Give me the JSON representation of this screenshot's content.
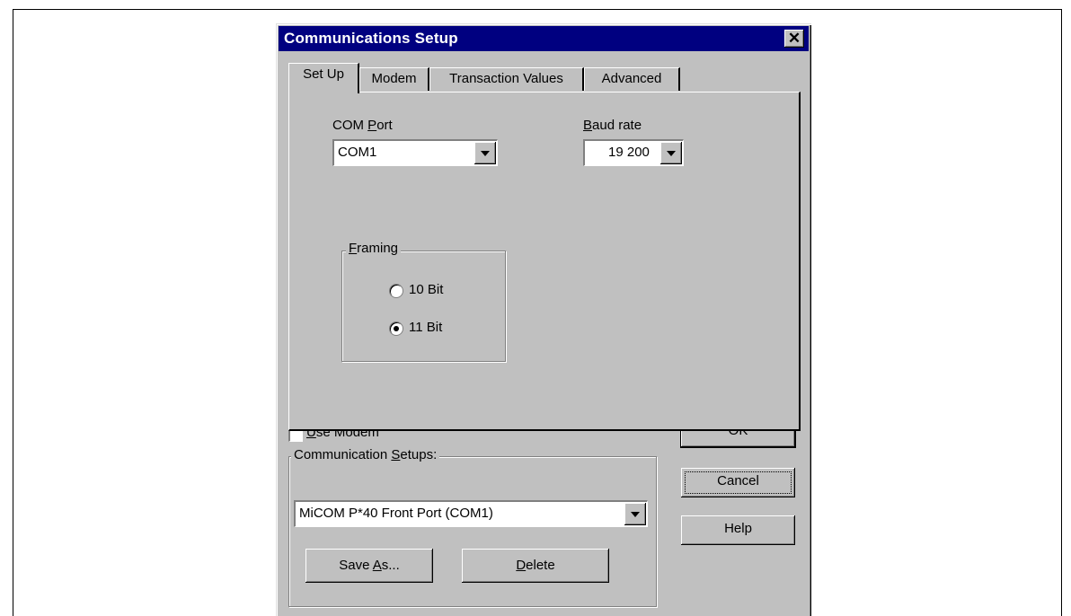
{
  "dialog": {
    "title": "Communications Setup",
    "close_symbol": "✕"
  },
  "tabs": [
    {
      "label": "Set Up",
      "active": true
    },
    {
      "label": "Modem",
      "active": false
    },
    {
      "label": "Transaction Values",
      "active": false
    },
    {
      "label": "Advanced",
      "active": false
    }
  ],
  "setup": {
    "com_port": {
      "label_first": "COM ",
      "label_mnemonic": "P",
      "label_rest": "ort",
      "value": "COM1"
    },
    "baud_rate": {
      "label_mnemonic": "B",
      "label_rest": "aud rate",
      "value": "19 200"
    },
    "framing": {
      "label_mnemonic": "F",
      "label_rest": "raming",
      "options": [
        {
          "label": "10 Bit",
          "selected": false
        },
        {
          "label": "11 Bit",
          "selected": true
        }
      ]
    }
  },
  "use_modem": {
    "label_mnemonic": "U",
    "label_rest": "se Modem",
    "checked": false
  },
  "communication_setups": {
    "label_first": "Communication ",
    "label_mnemonic": "S",
    "label_rest": "etups:",
    "value": "MiCOM P*40 Front Port (COM1)",
    "save_as": {
      "first": "Save ",
      "mnemonic": "A",
      "rest": "s..."
    },
    "delete": {
      "mnemonic": "D",
      "rest": "elete"
    }
  },
  "buttons": {
    "ok": "OK",
    "cancel": "Cancel",
    "help": "Help"
  }
}
